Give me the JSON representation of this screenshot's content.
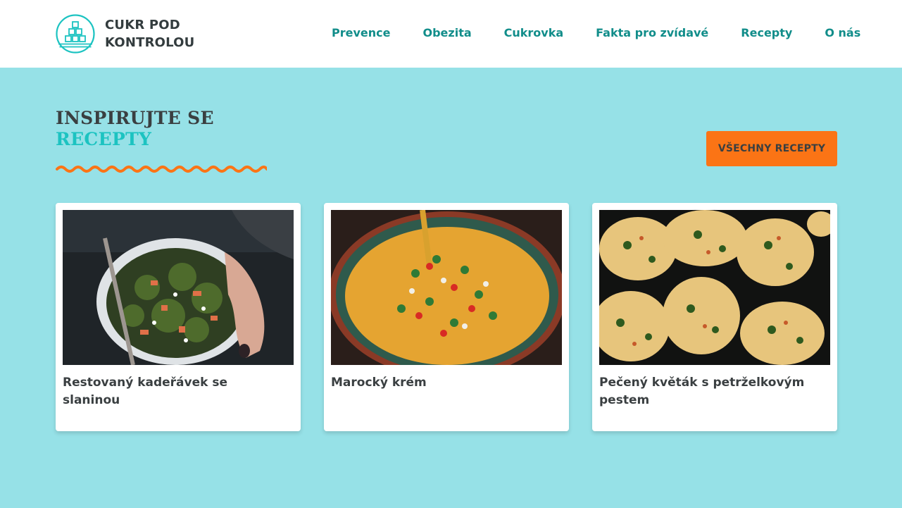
{
  "brand": {
    "line1": "CUKR POD",
    "line2": "KONTROLOU",
    "logo_icon": "sugar-cubes-logo-icon",
    "color": "#1cc3c1"
  },
  "nav": {
    "items": [
      {
        "label": "Prevence"
      },
      {
        "label": "Obezita"
      },
      {
        "label": "Cukrovka"
      },
      {
        "label": "Fakta pro zvídavé"
      },
      {
        "label": "Recepty"
      },
      {
        "label": "O nás"
      }
    ],
    "color": "#118d8a"
  },
  "section": {
    "title_line1": "INSPIRUJTE SE",
    "title_line2": "RECEPTY",
    "button_label": "VŠECHNY RECEPTY",
    "accent": "#fb7415",
    "background": "#96e1e7"
  },
  "recipes": [
    {
      "title": "Restovaný kadeřávek se slaninou",
      "image": "kale-salad-bowl-photo"
    },
    {
      "title": "Marocký krém",
      "image": "moroccan-soup-photo"
    },
    {
      "title": "Pečený květák s petrželkovým pestem",
      "image": "roasted-cauliflower-photo"
    }
  ]
}
